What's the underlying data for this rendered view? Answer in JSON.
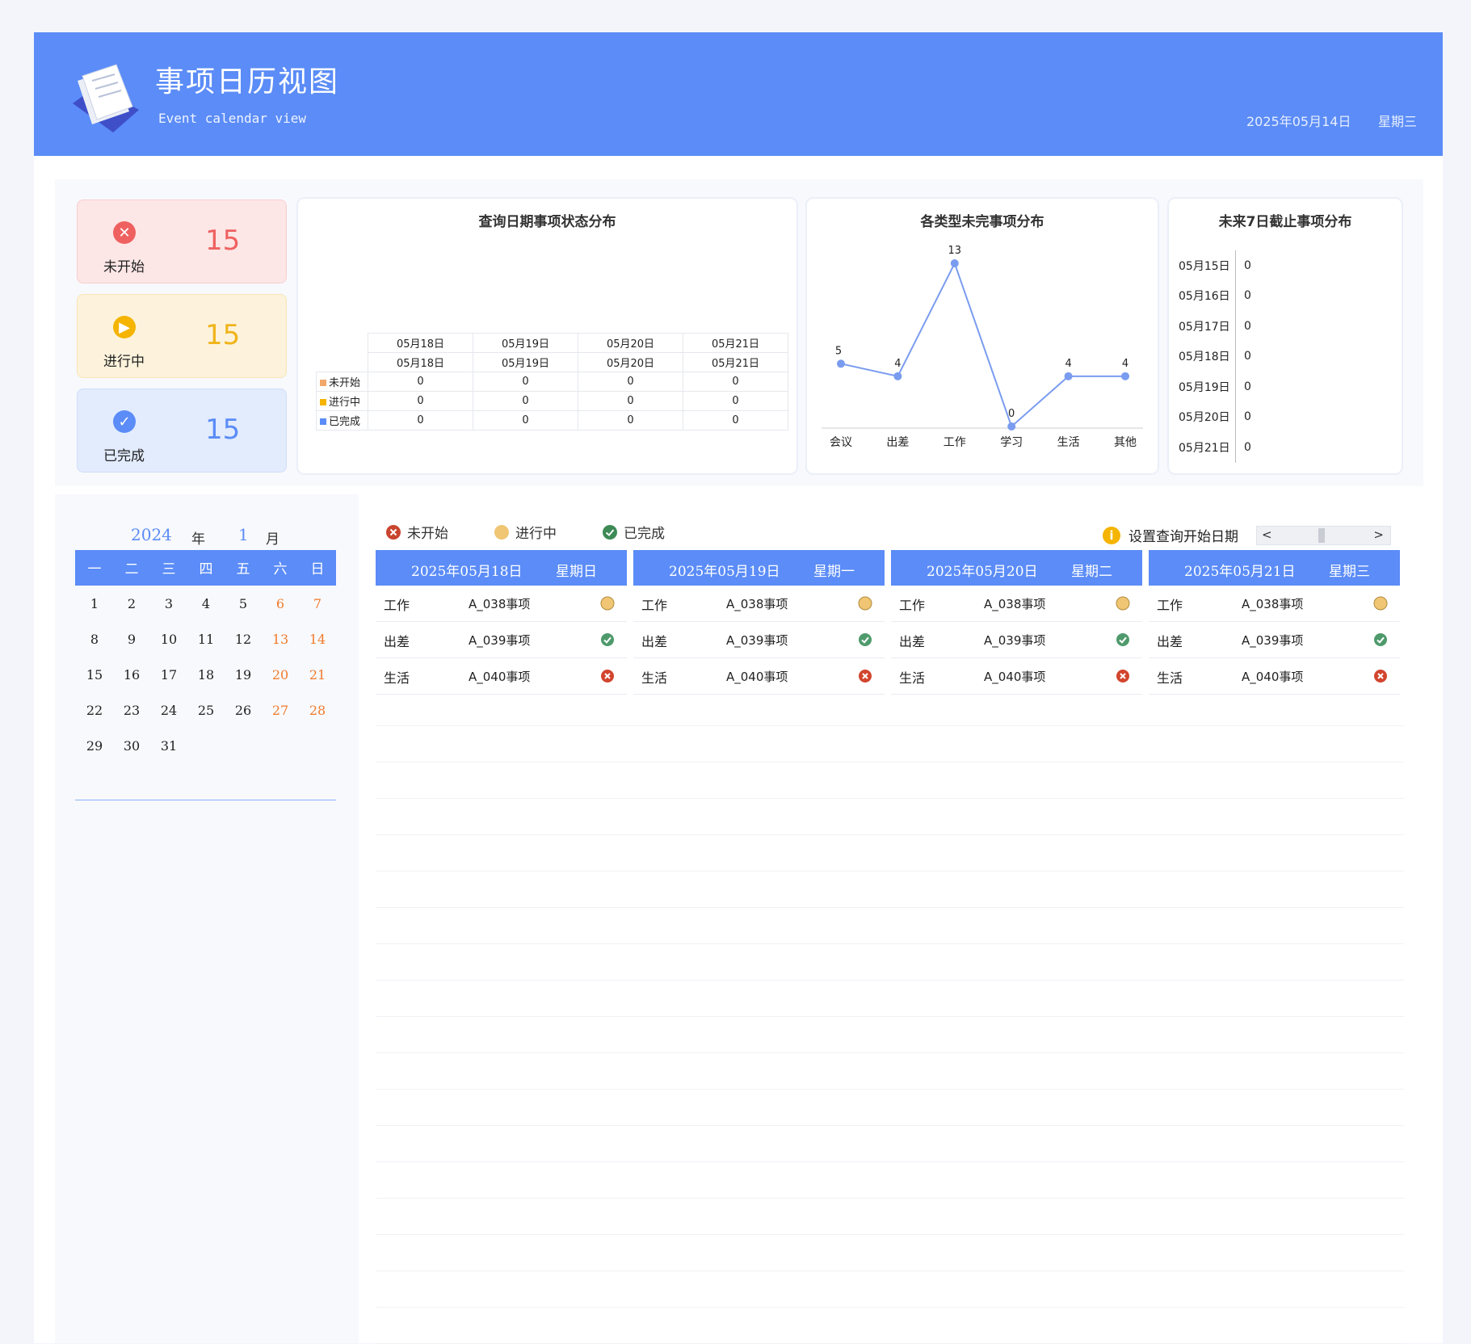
{
  "header": {
    "title": "事项日历视图",
    "subtitle": "Event calendar view",
    "date": "2025年05月14日",
    "weekday": "星期三"
  },
  "status_cards": [
    {
      "label": "未开始",
      "count": "15",
      "icon": "x-circle-icon",
      "color": "#ef6161"
    },
    {
      "label": "进行中",
      "count": "15",
      "icon": "play-circle-icon",
      "color": "#f4b400"
    },
    {
      "label": "已完成",
      "count": "15",
      "icon": "check-circle-icon",
      "color": "#5b8cf7"
    }
  ],
  "chart_data": [
    {
      "type": "table",
      "title": "查询日期事项状态分布",
      "categories": [
        "05月18日",
        "05月19日",
        "05月20日",
        "05月21日"
      ],
      "series": [
        {
          "name": "未开始",
          "values": [
            0,
            0,
            0,
            0
          ],
          "color": "#f2a86b"
        },
        {
          "name": "进行中",
          "values": [
            0,
            0,
            0,
            0
          ],
          "color": "#f4b400"
        },
        {
          "name": "已完成",
          "values": [
            0,
            0,
            0,
            0
          ],
          "color": "#5b8cf7"
        }
      ]
    },
    {
      "type": "line",
      "title": "各类型未完事项分布",
      "categories": [
        "会议",
        "出差",
        "工作",
        "学习",
        "生活",
        "其他"
      ],
      "values": [
        5,
        4,
        13,
        0,
        4,
        4
      ],
      "color": "#7a9cf0",
      "ylim": [
        0,
        13
      ]
    },
    {
      "type": "bar",
      "title": "未来7日截止事项分布",
      "categories": [
        "05月15日",
        "05月16日",
        "05月17日",
        "05月18日",
        "05月19日",
        "05月20日",
        "05月21日"
      ],
      "values": [
        0,
        0,
        0,
        0,
        0,
        0,
        0
      ]
    }
  ],
  "calendar": {
    "year": "2024",
    "year_unit": "年",
    "month": "1",
    "month_unit": "月",
    "weekdays": [
      "一",
      "二",
      "三",
      "四",
      "五",
      "六",
      "日"
    ],
    "weeks": [
      [
        "1",
        "2",
        "3",
        "4",
        "5",
        "6",
        "7"
      ],
      [
        "8",
        "9",
        "10",
        "11",
        "12",
        "13",
        "14"
      ],
      [
        "15",
        "16",
        "17",
        "18",
        "19",
        "20",
        "21"
      ],
      [
        "22",
        "23",
        "24",
        "25",
        "26",
        "27",
        "28"
      ],
      [
        "29",
        "30",
        "31",
        "",
        "",
        "",
        ""
      ]
    ]
  },
  "legend": [
    {
      "label": "未开始",
      "icon": "x-circle-icon"
    },
    {
      "label": "进行中",
      "icon": "dot-icon"
    },
    {
      "label": "已完成",
      "icon": "check-circle-icon"
    }
  ],
  "query": {
    "label": "设置查询开始日期",
    "prev": "<",
    "next": ">"
  },
  "day_columns": [
    {
      "date": "2025年05月18日",
      "weekday": "星期日",
      "items": [
        {
          "category": "工作",
          "name": "A_038事项",
          "status": "in-progress"
        },
        {
          "category": "出差",
          "name": "A_039事项",
          "status": "done"
        },
        {
          "category": "生活",
          "name": "A_040事项",
          "status": "not-started"
        }
      ]
    },
    {
      "date": "2025年05月19日",
      "weekday": "星期一",
      "items": [
        {
          "category": "工作",
          "name": "A_038事项",
          "status": "in-progress"
        },
        {
          "category": "出差",
          "name": "A_039事项",
          "status": "done"
        },
        {
          "category": "生活",
          "name": "A_040事项",
          "status": "not-started"
        }
      ]
    },
    {
      "date": "2025年05月20日",
      "weekday": "星期二",
      "items": [
        {
          "category": "工作",
          "name": "A_038事项",
          "status": "in-progress"
        },
        {
          "category": "出差",
          "name": "A_039事项",
          "status": "done"
        },
        {
          "category": "生活",
          "name": "A_040事项",
          "status": "not-started"
        }
      ]
    },
    {
      "date": "2025年05月21日",
      "weekday": "星期三",
      "items": [
        {
          "category": "工作",
          "name": "A_038事项",
          "status": "in-progress"
        },
        {
          "category": "出差",
          "name": "A_039事项",
          "status": "done"
        },
        {
          "category": "生活",
          "name": "A_040事项",
          "status": "not-started"
        }
      ]
    }
  ]
}
